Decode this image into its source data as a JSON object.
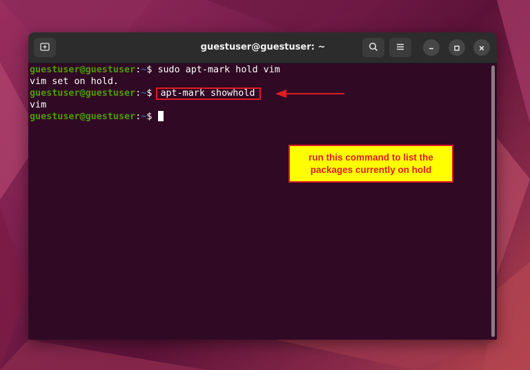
{
  "window": {
    "title": "guestuser@guestuser: ~"
  },
  "icons": {
    "new_tab": "new-tab-icon",
    "search": "search-icon",
    "menu": "hamburger-menu-icon",
    "minimize": "minimize-icon",
    "maximize": "maximize-icon",
    "close": "close-icon"
  },
  "terminal": {
    "prompt_user": "guestuser@guestuser",
    "prompt_sep": ":",
    "prompt_path": "~",
    "prompt_symbol": "$ ",
    "lines": [
      {
        "type": "prompt",
        "command": "sudo apt-mark hold vim"
      },
      {
        "type": "output",
        "text": "vim set on hold."
      },
      {
        "type": "prompt",
        "command": "apt-mark showhold",
        "highlighted": true
      },
      {
        "type": "output",
        "text": "vim"
      },
      {
        "type": "prompt",
        "command": "",
        "cursor": true
      }
    ]
  },
  "annotation": {
    "text": "run this command to list the packages currently on hold",
    "box_color": "#ffff00",
    "text_color": "#e01b24",
    "arrow_color": "#e01b24"
  },
  "colors": {
    "terminal_bg": "#300a24",
    "titlebar_bg": "#2c2c2c",
    "prompt_user": "#4e9a06",
    "prompt_path": "#3465a4"
  }
}
